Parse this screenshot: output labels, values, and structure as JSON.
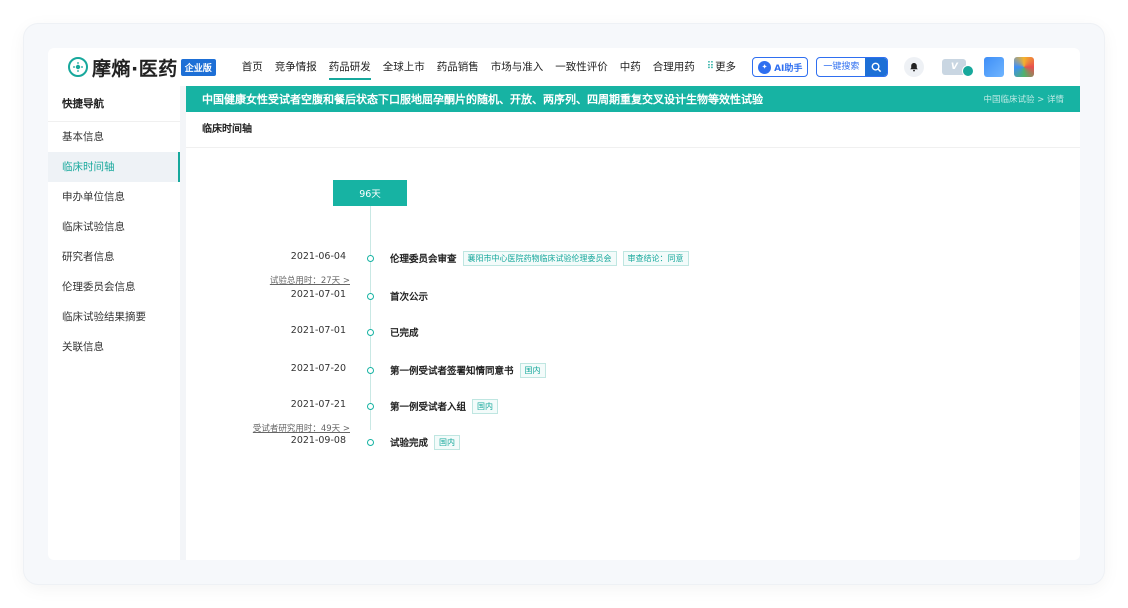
{
  "header": {
    "logo_text": "摩熵·医药",
    "edition_badge": "企业版",
    "nav": [
      {
        "label": "首页"
      },
      {
        "label": "竞争情报"
      },
      {
        "label": "药品研发",
        "active": true
      },
      {
        "label": "全球上市"
      },
      {
        "label": "药品销售"
      },
      {
        "label": "市场与准入"
      },
      {
        "label": "一致性评价"
      },
      {
        "label": "中药"
      },
      {
        "label": "合理用药"
      }
    ],
    "more_label": "更多",
    "ai_label": "AI助手",
    "search_label": "一键搜索",
    "colors": {
      "accent": "#17b3a3",
      "brand_blue": "#1d6fd6"
    }
  },
  "sidebar": {
    "title": "快捷导航",
    "items": [
      {
        "label": "基本信息"
      },
      {
        "label": "临床时间轴",
        "active": true
      },
      {
        "label": "申办单位信息"
      },
      {
        "label": "临床试验信息"
      },
      {
        "label": "研究者信息"
      },
      {
        "label": "伦理委员会信息"
      },
      {
        "label": "临床试验结果摘要"
      },
      {
        "label": "关联信息"
      }
    ]
  },
  "main": {
    "title": "中国健康女性受试者空腹和餐后状态下口服地屈孕酮片的随机、开放、两序列、四周期重复交叉设计生物等效性试验",
    "breadcrumb": "中国临床试验 > 详情",
    "section_title": "临床时间轴",
    "duration_label": "96天",
    "events": [
      {
        "date": "2021-06-04",
        "event": "伦理委员会审查",
        "tags": [
          "襄阳市中心医院药物临床试验伦理委员会",
          "审查结论：同意"
        ]
      },
      {
        "date": "2021-07-01",
        "event": "首次公示",
        "tags": [],
        "interval_before": "试验总用时：27天 >"
      },
      {
        "date": "2021-07-01",
        "event": "已完成",
        "tags": []
      },
      {
        "date": "2021-07-20",
        "event": "第一例受试者签署知情同意书",
        "tags": [
          "国内"
        ]
      },
      {
        "date": "2021-07-21",
        "event": "第一例受试者入组",
        "tags": [
          "国内"
        ]
      },
      {
        "date": "2021-09-08",
        "event": "试验完成",
        "tags": [
          "国内"
        ],
        "interval_before": "受试者研究用时：49天 >"
      }
    ]
  }
}
